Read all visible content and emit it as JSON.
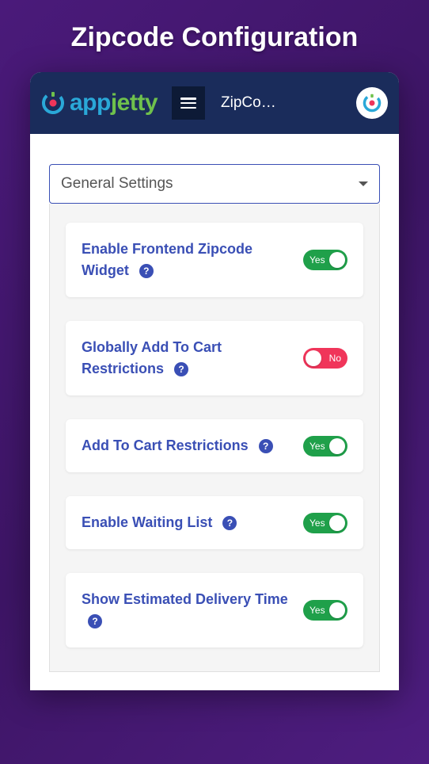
{
  "page": {
    "title": "Zipcode Configuration"
  },
  "header": {
    "logo": {
      "prefix": "app",
      "suffix": "jetty"
    },
    "title": "ZipCo…"
  },
  "section_select": {
    "label": "General Settings"
  },
  "toggle_labels": {
    "on": "Yes",
    "off": "No"
  },
  "settings": [
    {
      "label": "Enable Frontend Zipcode Widget",
      "enabled": true
    },
    {
      "label": "Globally Add To Cart Restrictions",
      "enabled": false
    },
    {
      "label": "Add To Cart Restrictions",
      "enabled": true
    },
    {
      "label": "Enable Waiting List",
      "enabled": true
    },
    {
      "label": "Show Estimated Delivery Time",
      "enabled": true
    }
  ]
}
